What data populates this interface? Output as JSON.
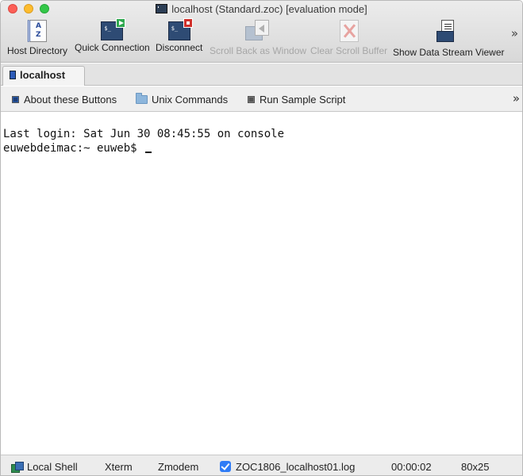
{
  "window": {
    "title": "localhost (Standard.zoc) [evaluation mode]"
  },
  "toolbar": {
    "items": [
      {
        "label": "Host Directory",
        "icon": "address-book-icon",
        "enabled": true
      },
      {
        "label": "Quick Connection",
        "icon": "terminal-connect-icon",
        "enabled": true
      },
      {
        "label": "Disconnect",
        "icon": "terminal-disconnect-icon",
        "enabled": true
      },
      {
        "label": "Scroll Back as Window",
        "icon": "scroll-back-icon",
        "enabled": false
      },
      {
        "label": "Clear Scroll Buffer",
        "icon": "clear-buffer-icon",
        "enabled": false
      },
      {
        "label": "Show Data Stream Viewer",
        "icon": "data-stream-icon",
        "enabled": true
      }
    ],
    "overflow": "»"
  },
  "tabs": [
    {
      "label": "localhost",
      "active": true
    }
  ],
  "buttonbar": {
    "items": [
      {
        "label": "About these Buttons",
        "icon": "square-button-icon"
      },
      {
        "label": "Unix Commands",
        "icon": "folder-icon"
      },
      {
        "label": "Run Sample Script",
        "icon": "square-button-icon"
      }
    ],
    "overflow": "»"
  },
  "terminal": {
    "lines": [
      "Last login: Sat Jun 30 08:45:55 on console",
      "euwebdeimac:~ euweb$ "
    ]
  },
  "statusbar": {
    "connection": "Local Shell",
    "emulation": "Xterm",
    "transfer": "Zmodem",
    "logfile": "ZOC1806_localhost01.log",
    "logging_enabled": true,
    "elapsed": "00:00:02",
    "size": "80x25"
  },
  "colors": {
    "accent": "#2f7cf6",
    "traffic_close": "#fc5f57",
    "traffic_minimize": "#fdbc2e",
    "traffic_maximize": "#33c748"
  }
}
